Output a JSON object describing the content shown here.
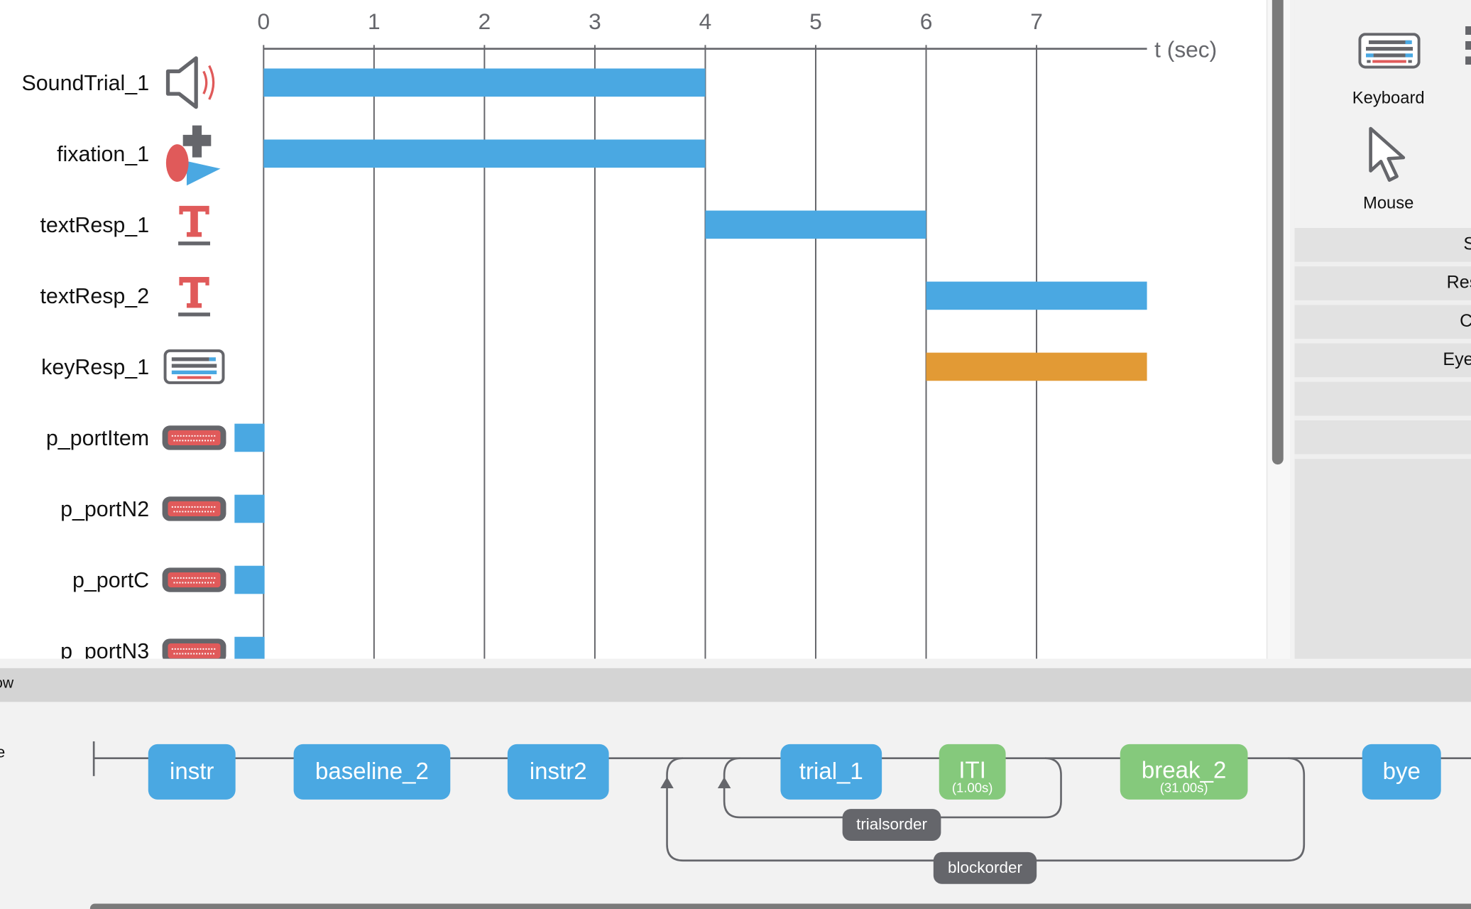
{
  "chart_data": {
    "type": "bar",
    "orientation": "horizontal-timeline",
    "xlabel": "t (sec)",
    "xticks": [
      0,
      1,
      2,
      3,
      4,
      5,
      6,
      7
    ],
    "xlim": [
      0,
      8
    ],
    "grid": true,
    "rows": [
      {
        "name": "SoundTrial_1",
        "icon": "speaker-icon",
        "start": 0,
        "end": 4,
        "color": "#4aa8e2"
      },
      {
        "name": "fixation_1",
        "icon": "shapes-icon",
        "start": 0,
        "end": 4,
        "color": "#4aa8e2"
      },
      {
        "name": "textResp_1",
        "icon": "text-icon",
        "start": 4,
        "end": 6,
        "color": "#4aa8e2"
      },
      {
        "name": "textResp_2",
        "icon": "text-icon",
        "start": 6,
        "end": 8,
        "color": "#4aa8e2"
      },
      {
        "name": "keyResp_1",
        "icon": "keyboard-icon",
        "start": 6,
        "end": 8,
        "color": "#e29a35"
      },
      {
        "name": "p_portItem",
        "icon": "parallel-port-icon",
        "start": 0,
        "end": 0,
        "color": "#4aa8e2"
      },
      {
        "name": "p_portN2",
        "icon": "parallel-port-icon",
        "start": 0,
        "end": 0,
        "color": "#4aa8e2"
      },
      {
        "name": "p_portC",
        "icon": "parallel-port-icon",
        "start": 0,
        "end": 0,
        "color": "#4aa8e2"
      },
      {
        "name": "p_portN3",
        "icon": "parallel-port-icon",
        "start": 0,
        "end": 0,
        "color": "#4aa8e2"
      }
    ]
  },
  "components_panel": {
    "devices": [
      {
        "label": "Keyboard",
        "icon": "keyboard-icon"
      },
      {
        "label": "Mouse",
        "icon": "mouse-cursor-icon"
      }
    ],
    "categories": [
      "S",
      "Res",
      "C",
      "Eye",
      "",
      ""
    ]
  },
  "flow": {
    "title": "ow",
    "side_label": "e",
    "routines": [
      {
        "name": "instr",
        "type": "routine"
      },
      {
        "name": "baseline_2",
        "type": "routine"
      },
      {
        "name": "instr2",
        "type": "routine"
      },
      {
        "name": "trial_1",
        "type": "routine"
      },
      {
        "name": "ITI",
        "type": "pause",
        "duration": "(1.00s)"
      },
      {
        "name": "break_2",
        "type": "pause",
        "duration": "(31.00s)"
      },
      {
        "name": "bye",
        "type": "routine"
      }
    ],
    "loops": [
      {
        "name": "trialsorder"
      },
      {
        "name": "blockorder"
      }
    ]
  },
  "colors": {
    "routine": "#4aa8e2",
    "pause": "#85c97c",
    "keyResp": "#e29a35",
    "loop": "#65666b"
  }
}
